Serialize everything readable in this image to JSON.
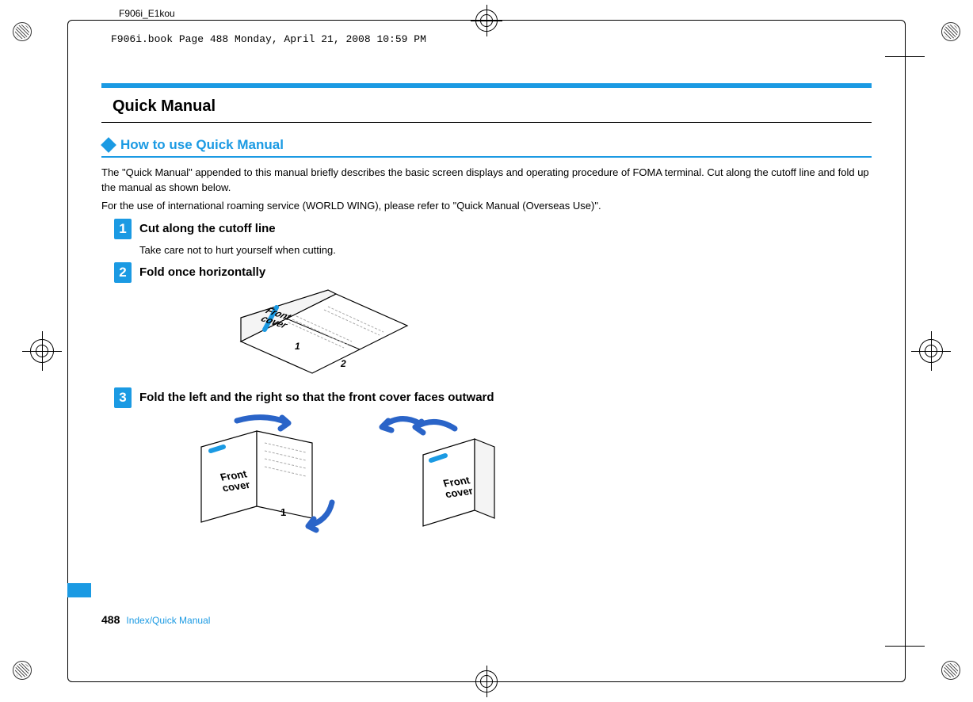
{
  "doc_id": "F906i_E1kou",
  "print_info": "F906i.book  Page 488  Monday, April 21, 2008  10:59 PM",
  "section_title": "Quick Manual",
  "subsection": "How to use Quick Manual",
  "intro_line1": "The \"Quick Manual\" appended to this manual briefly describes the basic screen displays and operating procedure of FOMA terminal. Cut along the cutoff line and fold up the manual as shown below.",
  "intro_line2": "For the use of international roaming service (WORLD WING), please refer to \"Quick Manual (Overseas Use)\".",
  "steps": [
    {
      "num": "1",
      "title": "Cut along the cutoff line",
      "note": "Take care not to hurt yourself when cutting."
    },
    {
      "num": "2",
      "title": "Fold once horizontally",
      "note": ""
    },
    {
      "num": "3",
      "title": "Fold the left and the right so that the front cover faces outward",
      "note": ""
    }
  ],
  "illus_label": "Front cover",
  "footer": {
    "page": "488",
    "section": "Index/Quick Manual"
  }
}
